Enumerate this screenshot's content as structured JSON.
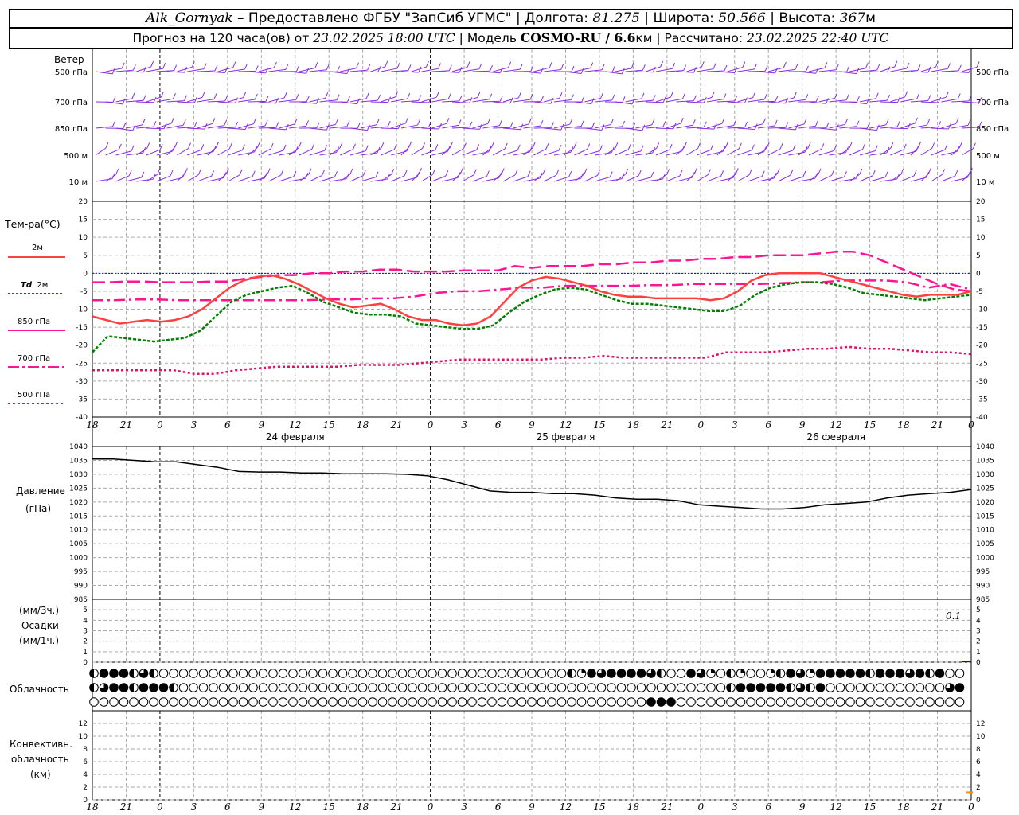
{
  "header": {
    "station": "Alk_Gornyak",
    "provided": " – Предоставлено ФГБУ \"ЗапСиб УГМС\" | Долгота: ",
    "lon": "81.275",
    "lat_label": " | Широта: ",
    "lat": "50.566",
    "alt_label": " | Высота: ",
    "alt": "367",
    "alt_unit": "м",
    "forecast_label": "Прогноз на 120 часа(ов) от ",
    "forecast_time": "23.02.2025 18:00 UTC",
    "model_label": "  | Модель ",
    "model": "COSMO-RU / 6.6",
    "model_unit": "км",
    "calc_label": " | Рассчитано: ",
    "calc_time": "23.02.2025 22:40 UTC"
  },
  "labels": {
    "wind": "Ветер",
    "wind_levels": [
      "500 гПа",
      "700 гПа",
      "850 гПа",
      "500 м",
      "10 м"
    ],
    "temp_title": "Тем-ра(°C)",
    "legend_2m": "2м",
    "legend_td": "Td",
    "legend_td2": "2м",
    "legend_850": "850 гПа",
    "legend_700": "700 гПа",
    "legend_500": "500 гПа",
    "pressure_title": "Давление",
    "pressure_unit": "(гПа)",
    "precip_unit1": "(мм/3ч.)",
    "precip_title": "Осадки",
    "precip_unit2": "(мм/1ч.)",
    "precip_max": "0.1",
    "cloud_title": "Облачность",
    "conv_title1": "Конвективн.",
    "conv_title2": "облачность",
    "conv_unit": "(км)"
  },
  "colors": {
    "t2m": "#ff4040",
    "td": "#008000",
    "t850": "#ff1493",
    "t700": "#ff1493",
    "t500": "#e0106a",
    "wind": "#8a2be2",
    "pressure": "#000000",
    "zero_line": "#0000ff",
    "conv": "#ff8c00"
  },
  "chart_data": [
    {
      "type": "line",
      "title": "Тем-ра(°C)",
      "ylim": [
        -40,
        20
      ],
      "yticks": [
        -40,
        -35,
        -30,
        -25,
        -20,
        -15,
        -10,
        -5,
        0,
        5,
        10,
        15,
        20
      ],
      "x_hours": [
        0,
        3,
        6,
        9,
        12,
        15,
        18,
        21,
        24,
        27,
        30,
        33,
        36,
        39,
        42,
        45,
        48,
        51,
        54,
        57,
        60,
        63,
        66,
        69,
        72,
        75,
        78,
        81,
        84,
        87,
        90,
        93,
        96,
        99,
        102,
        105,
        108,
        111,
        114,
        117,
        120,
        123,
        126,
        129,
        132,
        135,
        138,
        141,
        144,
        147,
        150,
        153,
        156,
        159,
        162,
        165,
        168,
        171,
        174,
        177,
        180,
        183,
        186,
        189,
        192,
        195,
        198,
        201,
        204,
        207,
        210,
        213,
        216,
        219,
        222,
        225,
        228,
        231,
        234
      ],
      "x_tick_labels": [
        "18",
        "21",
        "0",
        "3",
        "6",
        "9",
        "12",
        "15",
        "18",
        "21",
        "0",
        "3",
        "6",
        "9",
        "12",
        "15",
        "18",
        "21",
        "0",
        "3",
        "6",
        "9",
        "12",
        "15",
        "18",
        "21",
        "0"
      ],
      "day_labels": [
        "24 февраля",
        "25 февраля",
        "26 февраля"
      ],
      "series": [
        {
          "name": "2м",
          "values": [
            -12,
            -13,
            -14,
            -13.5,
            -13,
            -13.5,
            -13,
            -12,
            -10,
            -7,
            -4,
            -2,
            -1,
            -0.5,
            -1.5,
            -3,
            -5,
            -7,
            -8.5,
            -9.5,
            -9,
            -8.5,
            -10,
            -12,
            -13,
            -13,
            -14,
            -14.5,
            -14,
            -12,
            -8,
            -4,
            -2,
            -1,
            -1.5,
            -2.5,
            -3.5,
            -5,
            -6,
            -6.5,
            -6.5,
            -7,
            -7,
            -7,
            -7,
            -7.5,
            -7,
            -5,
            -2,
            -0.5,
            0,
            0,
            0,
            0,
            -1,
            -2,
            -3,
            -4,
            -5,
            -6,
            -6.5,
            -6,
            -6,
            -6,
            -5
          ]
        },
        {
          "name": "Td 2м",
          "values": [
            -22,
            -17.5,
            -18,
            -18.5,
            -19,
            -18.5,
            -18,
            -16,
            -12,
            -8,
            -6,
            -5,
            -4,
            -3.5,
            -5.5,
            -8,
            -9.5,
            -11,
            -11.5,
            -11.5,
            -12,
            -14,
            -14.5,
            -15,
            -15.5,
            -15.5,
            -14.5,
            -11,
            -8,
            -6,
            -4.5,
            -4,
            -4.5,
            -6,
            -7.5,
            -8.5,
            -8.5,
            -9,
            -9.5,
            -10,
            -10.5,
            -10.5,
            -9,
            -6,
            -4,
            -3,
            -2.5,
            -2.5,
            -3,
            -4,
            -5.5,
            -6,
            -6.5,
            -7,
            -7.5,
            -7,
            -6.5,
            -6
          ]
        },
        {
          "name": "850 гПа",
          "values": [
            -2.5,
            -2.5,
            -2.3,
            -2.3,
            -2.5,
            -2.5,
            -2.5,
            -2.3,
            -2.3,
            -1.5,
            -1,
            -0.5,
            -0.5,
            0,
            0,
            0.5,
            0.5,
            1,
            1,
            0.5,
            0.5,
            0.5,
            0.8,
            0.8,
            0.8,
            2,
            1.5,
            2,
            2,
            2,
            2.5,
            2.5,
            3,
            3,
            3.5,
            3.5,
            4,
            4,
            4.5,
            4.5,
            5,
            5,
            5,
            5.5,
            6,
            6,
            5,
            3,
            1,
            -1,
            -3,
            -4.5,
            -5
          ]
        },
        {
          "name": "700 гПа",
          "values": [
            -7.5,
            -7.5,
            -7.3,
            -7.3,
            -7.5,
            -7.5,
            -7.5,
            -7.5,
            -7.5,
            -7.5,
            -7.5,
            -7.3,
            -7.3,
            -7,
            -7,
            -6.5,
            -5.5,
            -5,
            -5,
            -4.5,
            -4,
            -4,
            -3.5,
            -3.5,
            -3.5,
            -3.5,
            -3.3,
            -3.3,
            -3,
            -3,
            -3,
            -3,
            -2.8,
            -2.5,
            -2.5,
            -2,
            -2,
            -2,
            -2.5,
            -4,
            -3,
            -4.5
          ]
        },
        {
          "name": "500 гПа",
          "values": [
            -27,
            -27,
            -27,
            -27,
            -27,
            -28,
            -28,
            -27,
            -26.5,
            -26,
            -26,
            -26,
            -26,
            -25.5,
            -25.5,
            -25.5,
            -25,
            -24.5,
            -24,
            -24,
            -24,
            -24,
            -24,
            -23.5,
            -23.5,
            -23,
            -23.5,
            -23.5,
            -23.5,
            -23.5,
            -23.5,
            -22,
            -22,
            -22,
            -21.5,
            -21,
            -21,
            -20.5,
            -21,
            -21,
            -21.5,
            -22,
            -22,
            -22.5
          ]
        }
      ]
    },
    {
      "type": "line",
      "title": "Давление",
      "ylim": [
        985,
        1040
      ],
      "yticks": [
        985,
        990,
        995,
        1000,
        1005,
        1010,
        1015,
        1020,
        1025,
        1030,
        1035,
        1040
      ],
      "series": [
        {
          "name": "Давление",
          "values": [
            1035.5,
            1035.5,
            1035,
            1034.5,
            1034.5,
            1033.5,
            1032.5,
            1031,
            1030.8,
            1030.8,
            1030.5,
            1030.5,
            1030.2,
            1030.2,
            1030.2,
            1030,
            1029.5,
            1028,
            1026,
            1024,
            1023.5,
            1023.5,
            1023,
            1023,
            1022.5,
            1021.5,
            1021,
            1021,
            1020.5,
            1019,
            1018.5,
            1018,
            1017.5,
            1017.5,
            1018,
            1019,
            1019.5,
            1020,
            1021.5,
            1022.5,
            1023,
            1023.5,
            1024.5
          ]
        }
      ]
    },
    {
      "type": "bar",
      "title": "Осадки",
      "ylim": [
        0,
        5
      ],
      "yticks": [
        0,
        1,
        2,
        3,
        4,
        5
      ],
      "values_max": 0.1
    },
    {
      "type": "table",
      "title": "Облачность",
      "rows": [
        "hfffhqhooooooooooooooooooooooooooooooooooooooooohtfqffffqhoofqtohtoothfqtfffffhfffqfhf",
        "hqffhfffhooooooooooooooooooooooooooooooooooooooooooooooooooooooohfffffhqhfooooooooooooqfhf",
        "oooooooooooooooooooooooooooooooooooooooooooooooooooooooofffooooooooooooooooooooooooooooohff"
      ]
    },
    {
      "type": "line",
      "title": "Конвективн. облачность",
      "ylim": [
        0,
        13
      ],
      "yticks": [
        0,
        2,
        4,
        6,
        8,
        10,
        12
      ],
      "values_last": 1.2
    }
  ]
}
